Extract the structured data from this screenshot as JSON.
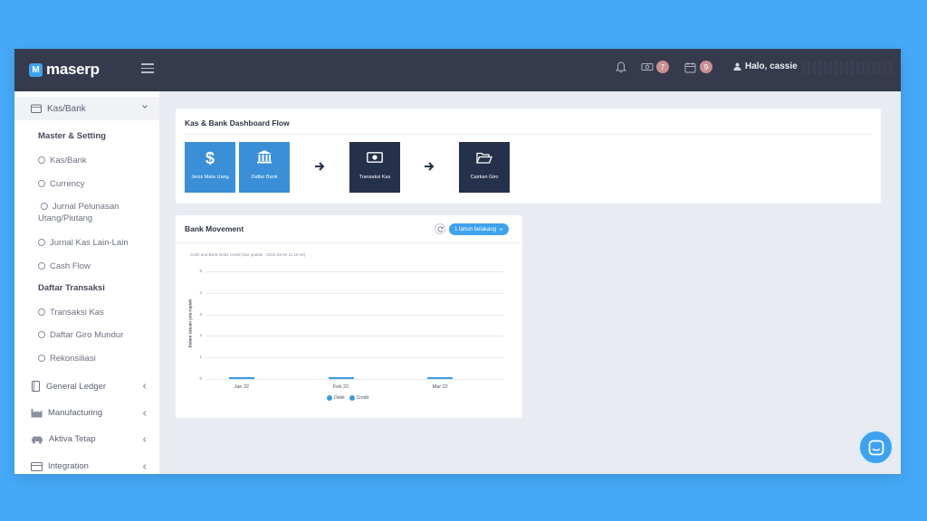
{
  "brand": {
    "logo_letter": "M",
    "name": "maserp"
  },
  "topbar": {
    "greeting": "Halo, cassie",
    "badge_money": "7",
    "badge_calendar": "9",
    "icons": [
      "bell-icon",
      "money-icon",
      "calendar-icon",
      "user-icon"
    ]
  },
  "sidebar": {
    "header": "Kas/Bank",
    "sections": [
      {
        "title": "Master & Setting",
        "items": [
          "Kas/Bank",
          "Currency",
          "Jurnal Pelunasan Utang/Piutang",
          "Jurnal Kas Lain-Lain",
          "Cash Flow"
        ]
      },
      {
        "title": "Daftar Transaksi",
        "items": [
          "Transaksi Kas",
          "Daftar Giro Mundur",
          "Rekonsiliasi"
        ]
      }
    ],
    "modules": [
      "General Ledger",
      "Manufacturing",
      "Aktiva Tetap",
      "Integration"
    ]
  },
  "flow": {
    "title": "Kas & Bank Dashboard Flow",
    "tiles": [
      {
        "label": "Jenis Mata Uang",
        "icon": "dollar-icon",
        "color": "#3a8fd6"
      },
      {
        "label": "Daftar Bank",
        "icon": "bank-icon",
        "color": "#3a8fd6"
      },
      {
        "label": "Transaksi Kas",
        "icon": "cash-icon",
        "color": "#25304a"
      },
      {
        "label": "Cairkan Giro",
        "icon": "folder-open-icon",
        "color": "#25304a"
      }
    ]
  },
  "bank_movement": {
    "title": "Bank Movement",
    "period": "1 tahun belakang",
    "subtitle": "Cash and Bank Debit Credit (last update : 2022-03-04 11:18:48)",
    "chart_data": {
      "type": "bar",
      "title": "",
      "ylabel": "Dalam satuan juta rupiah",
      "xlabel": "",
      "categories": [
        "Jan 22",
        "Feb 22",
        "Mar 22"
      ],
      "yticks": [
        "0",
        "1",
        "2",
        "3",
        "4",
        "5"
      ],
      "ylim": [
        0,
        5
      ],
      "grid": true,
      "legend_position": "bottom",
      "series": [
        {
          "name": "Debit",
          "values": [
            0,
            0,
            0
          ],
          "color": "#3a9be3"
        },
        {
          "name": "Credit",
          "values": [
            0,
            0,
            0
          ],
          "color": "#3a9be3"
        }
      ]
    }
  }
}
